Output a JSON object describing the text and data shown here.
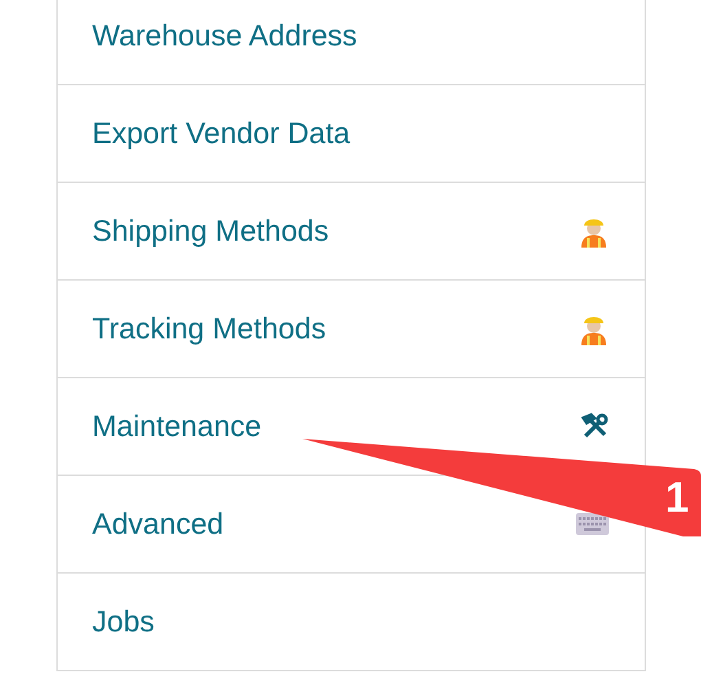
{
  "menu": {
    "items": [
      {
        "label": "Warehouse Address"
      },
      {
        "label": "Export Vendor Data"
      },
      {
        "label": "Shipping Methods",
        "kind": "worker"
      },
      {
        "label": "Tracking Methods",
        "kind": "worker"
      },
      {
        "label": "Maintenance",
        "kind": "tools"
      },
      {
        "label": "Advanced",
        "kind": "keyboard"
      },
      {
        "label": "Jobs"
      }
    ]
  },
  "annotation": {
    "label": "1"
  }
}
